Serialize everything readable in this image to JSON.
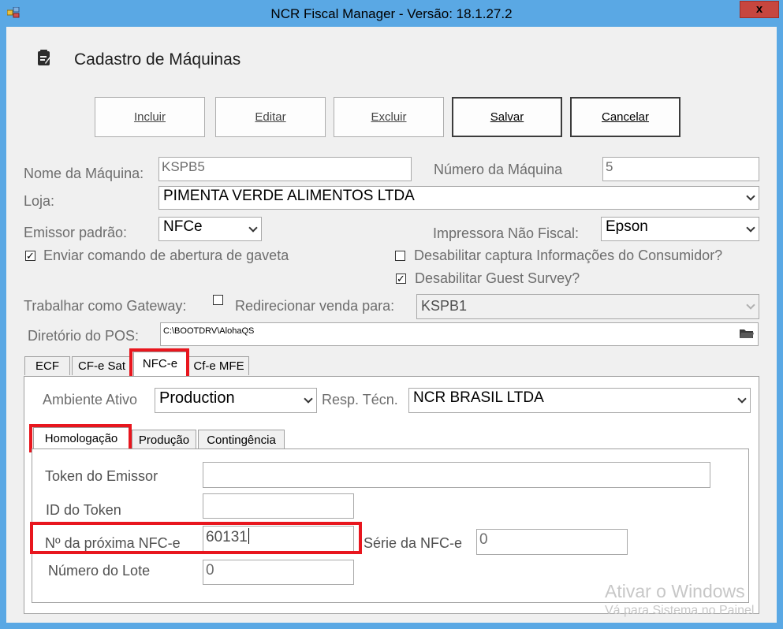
{
  "window": {
    "title": "NCR Fiscal Manager - Versão: 18.1.27.2",
    "close_label": "x"
  },
  "form": {
    "title": "Cadastro de Máquinas"
  },
  "toolbar": {
    "incluir_label": "Incluir",
    "editar_label": "Editar",
    "excluir_label": "Excluir",
    "salvar_label": "Salvar",
    "cancelar_label": "Cancelar"
  },
  "fields": {
    "nome_maquina_label": "Nome da Máquina:",
    "nome_maquina_value": "KSPB5",
    "numero_maquina_label": "Número da Máquina",
    "numero_maquina_value": "5",
    "loja_label": "Loja:",
    "loja_value": "PIMENTA VERDE ALIMENTOS LTDA",
    "emissor_label": "Emissor padrão:",
    "emissor_value": "NFCe",
    "impressora_label": "Impressora Não Fiscal:",
    "impressora_value": "Epson",
    "enviar_gaveta_label": "Enviar comando de abertura de gaveta",
    "enviar_gaveta_checked": true,
    "desab_captura_label": "Desabilitar captura Informações do Consumidor?",
    "desab_captura_checked": false,
    "desab_guest_label": "Desabilitar Guest Survey?",
    "desab_guest_checked": true,
    "gateway_label": "Trabalhar como Gateway:",
    "gateway_checked": false,
    "redirecionar_label": "Redirecionar venda para:",
    "redirecionar_value": "KSPB1",
    "diretorio_label": "Diretório do POS:",
    "diretorio_value": "C:\\BOOTDRV\\AlohaQS"
  },
  "tabs": {
    "ecf": "ECF",
    "cfe_sat": "CF-e Sat",
    "nfce": "NFC-e",
    "cfe_mfe": "Cf-e MFE"
  },
  "nfce": {
    "ambiente_label": "Ambiente Ativo",
    "ambiente_value": "Production",
    "resp_label": "Resp. Técn.",
    "resp_value": "NCR BRASIL LTDA",
    "subtabs": {
      "homologacao": "Homologação",
      "producao": "Produção",
      "contingencia": "Contingência"
    },
    "token_emissor_label": "Token do Emissor",
    "token_emissor_value": "",
    "id_token_label": "ID do Token",
    "id_token_value": "",
    "proxima_label": "Nº da próxima NFC-e",
    "proxima_value": "60131",
    "serie_label": "Série da NFC-e",
    "serie_value": "0",
    "lote_label": "Número do Lote",
    "lote_value": "0"
  },
  "watermark": {
    "line1": "Ativar o Windows",
    "line2": "Vá para Sistema no Painel"
  },
  "colors": {
    "titlebar": "#5aa8e4",
    "close": "#c7463f",
    "highlight": "#e8161e"
  }
}
